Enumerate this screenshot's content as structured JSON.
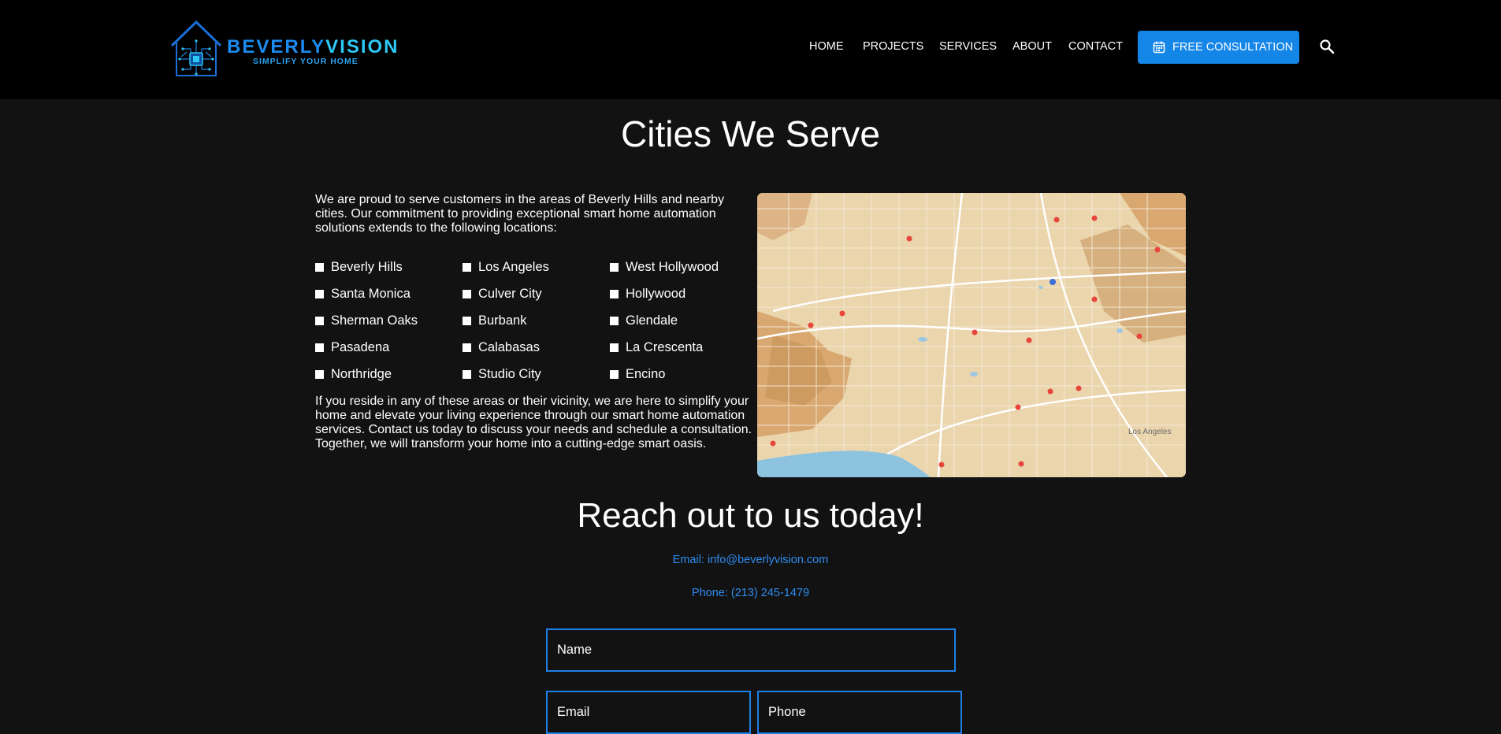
{
  "brand": {
    "name_part1": "BEVERLY",
    "name_part2": "VISION",
    "tagline": "SIMPLIFY YOUR HOME",
    "accent": "#1486e8"
  },
  "nav": {
    "items": [
      "HOME",
      "PROJECTS",
      "SERVICES",
      "ABOUT",
      "CONTACT"
    ],
    "cta_label": "FREE CONSULTATION",
    "cta_icon": "calendar-icon",
    "search_icon": "search-icon"
  },
  "cities": {
    "title": "Cities We Serve",
    "intro": "We are proud to serve customers in the areas of Beverly Hills and nearby cities. Our commitment to providing exceptional smart home automation solutions extends to the following locations:",
    "list": [
      "Beverly Hills",
      "Los Angeles",
      "West Hollywood",
      "Santa Monica",
      "Culver City",
      "Hollywood",
      "Sherman Oaks",
      "Burbank",
      "Glendale",
      "Pasadena",
      "Calabasas",
      "La Crescenta",
      "Northridge",
      "Studio City",
      "Encino"
    ],
    "outro": "If you reside in any of these areas or their vicinity, we are here to simplify your home and elevate your living experience through our smart home automation services. Contact us today to discuss your needs and schedule a consultation. Together, we will transform your home into a cutting-edge smart oasis.",
    "map_label": "Los Angeles"
  },
  "contact": {
    "title": "Reach out to us today!",
    "email": "Email: info@beverlyvision.com",
    "phone": "Phone: (213) 245-1479",
    "name_placeholder": "Name",
    "email_placeholder": "Email",
    "phone_placeholder": "Phone"
  }
}
